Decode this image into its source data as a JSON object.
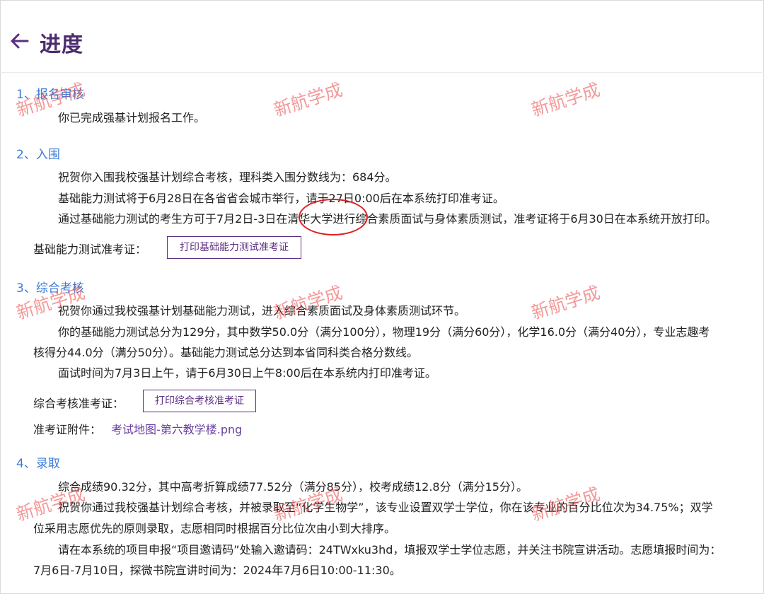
{
  "header": {
    "title": "进度"
  },
  "sections": {
    "s1": {
      "title": "1、报名审核",
      "lines": [
        "你已完成强基计划报名工作。"
      ]
    },
    "s2": {
      "title": "2、入围",
      "lines": [
        "祝贺你入围我校强基计划综合考核，理科类入围分数线为：684分。",
        "基础能力测试将于6月28日在各省省会城市举行，请于27日0:00后在本系统打印准考证。",
        "通过基础能力测试的考生方可于7月2日-3日在清华大学进行综合素质面试与身体素质测试，准考证将于6月30日在本系统开放打印。"
      ],
      "ticket_label": "基础能力测试准考证：",
      "button_label": "打印基础能力测试准考证"
    },
    "s3": {
      "title": "3、综合考核",
      "lines": [
        "祝贺你通过我校强基计划基础能力测试，进入综合素质面试及身体素质测试环节。",
        "你的基础能力测试总分为129分，其中数学50.0分（满分100分），物理19分（满分60分），化学16.0分（满分40分），专业志趣考",
        "核得分44.0分（满分50分）。基础能力测试总分达到本省同科类合格分数线。",
        "面试时间为7月3日上午，请于6月30日上午8:00后在本系统内打印准考证。"
      ],
      "ticket_label": "综合考核准考证：",
      "button_label": "打印综合考核准考证",
      "attachment_label": "准考证附件：",
      "attachment_link": "考试地图-第六教学楼.png"
    },
    "s4": {
      "title": "4、录取",
      "lines": [
        "综合成绩90.32分，其中高考折算成绩77.52分（满分85分），校考成绩12.8分（满分15分）。",
        "祝贺你通过我校强基计划综合考核，并被录取至“化学生物学”，该专业设置双学士学位，你在该专业的百分比位次为34.75%；双学",
        "位采用志愿优先的原则录取，志愿相同时根据百分比位次由小到大排序。",
        "请在本系统的项目申报“项目邀请码”处输入邀请码：24TWxku3hd，填报双学士学位志愿，并关注书院宣讲活动。志愿填报时间为：",
        "7月6日-7月10日，探微书院宣讲时间为：2024年7月6日10:00-11:30。"
      ]
    }
  },
  "watermark": {
    "text": "新航学成"
  },
  "colors": {
    "title": "#4b2c6f",
    "section_title": "#3d7bd9",
    "button_border": "#5b2e82",
    "link": "#6a3fa0",
    "watermark": "#eb4646",
    "annotation_circle": "#e02020"
  },
  "icons": {
    "back": "arrow-left-icon"
  }
}
